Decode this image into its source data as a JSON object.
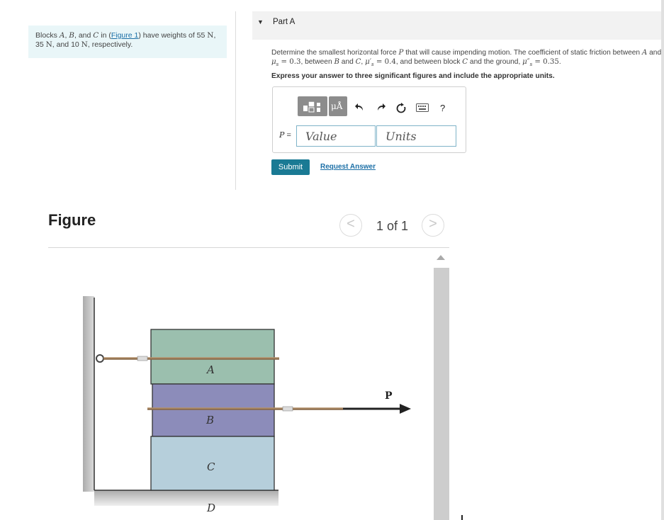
{
  "statement": {
    "t1": "Blocks ",
    "A": "A",
    "comma1": ", ",
    "B": "B",
    "and1": ", and ",
    "C": "C",
    "in": " in (",
    "figlink": "Figure 1",
    "have": ") have weights of 55 ",
    "N1": "N",
    "comma2": ",",
    "line2a": "35 ",
    "N2": "N",
    "line2b": ", and 10 ",
    "N3": "N",
    "line2c": ", respectively."
  },
  "part": {
    "label": "Part A"
  },
  "question": {
    "line1a": "Determine the smallest horizontal force ",
    "P": "P",
    "line1b": " that will cause impending motion. The coefficient of static friction between ",
    "A": "A",
    "line1c": " and",
    "mu1": "μ",
    "mu1sub": "s",
    "eq1": " = 0.3",
    "line2a": ", between ",
    "B": "B",
    "line2b": " and ",
    "C": "C",
    "line2c": ", ",
    "mu2": "μ′",
    "mu2sub": "s",
    "eq2": " = 0.4",
    "line2d": ", and between block ",
    "C2": "C",
    "line2e": " and the ground, ",
    "mu3": "μ″",
    "mu3sub": "s",
    "eq3": " = 0.35",
    "line2f": "."
  },
  "instruction": "Express your answer to three significant figures and include the appropriate units.",
  "toolbar": {
    "units_icon": "μÅ",
    "undo_icon": "undo-arrow",
    "redo_icon": "redo-arrow",
    "reset_icon": "reset-circle",
    "keyboard_icon": "keyboard",
    "help_label": "?"
  },
  "answer": {
    "label": "P",
    "eq": " =",
    "value_placeholder": "Value",
    "units_placeholder": "Units"
  },
  "buttons": {
    "submit": "Submit",
    "request": "Request Answer"
  },
  "figure": {
    "title": "Figure",
    "pager": "1 of 1",
    "prev": "<",
    "next": ">",
    "labels": {
      "A": "A",
      "B": "B",
      "C": "C",
      "D": "D",
      "P": "P"
    }
  },
  "colors": {
    "block_A": "#9bbfae",
    "block_B": "#8c8cba",
    "block_C": "#b6cfdb",
    "wall": "#c4c4c4",
    "accent": "#1a7a94",
    "link": "#1b6fa6"
  }
}
